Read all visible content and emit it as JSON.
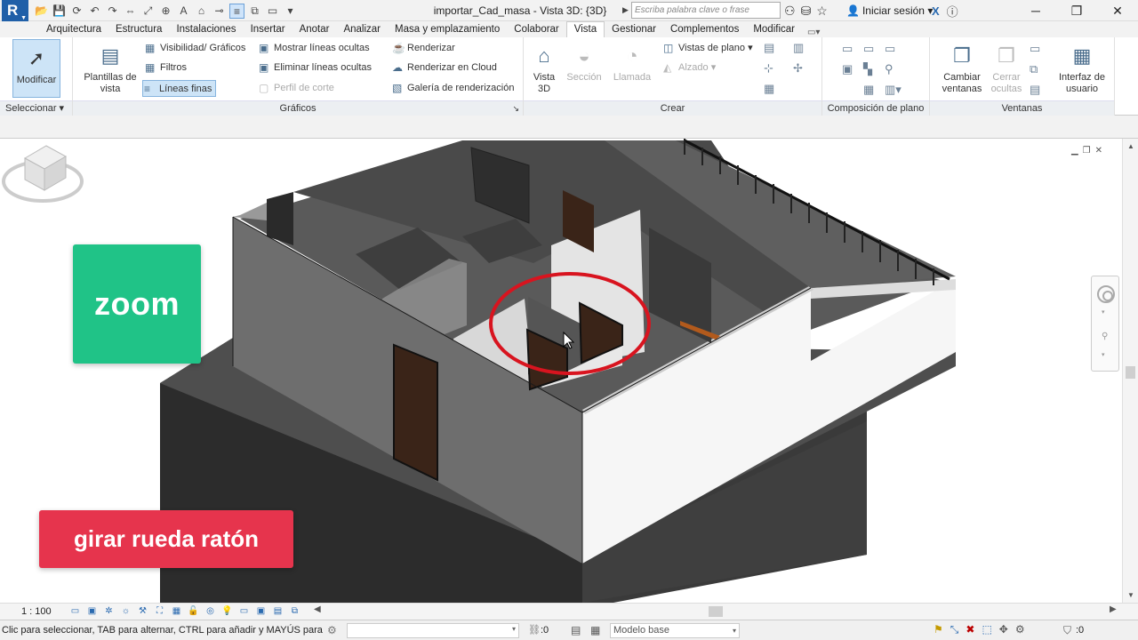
{
  "titlebar": {
    "doc_title": "importar_Cad_masa - Vista 3D: {3D}",
    "search_placeholder": "Escriba palabra clave o frase",
    "signin": "Iniciar sesión"
  },
  "tabs": [
    "Arquitectura",
    "Estructura",
    "Instalaciones",
    "Insertar",
    "Anotar",
    "Analizar",
    "Masa y emplazamiento",
    "Colaborar",
    "Vista",
    "Gestionar",
    "Complementos",
    "Modificar"
  ],
  "active_tab": "Vista",
  "ribbon": {
    "select": {
      "modificar": "Modificar",
      "label": "Seleccionar"
    },
    "graficos": {
      "plantillas": "Plantillas de vista",
      "visibilidad": "Visibilidad/ Gráficos",
      "filtros": "Filtros",
      "lineas_finas": "Líneas finas",
      "mostrar_lineas": "Mostrar líneas ocultas",
      "eliminar_lineas": "Eliminar líneas ocultas",
      "perfil_corte": "Perfil de corte",
      "renderizar": "Renderizar",
      "renderizar_cloud": "Renderizar  en Cloud",
      "galeria": "Galería de  renderización",
      "label": "Gráficos"
    },
    "crear": {
      "vista3d": "Vista 3D",
      "seccion": "Sección",
      "llamada": "Llamada",
      "vistas_plano": "Vistas de plano",
      "alzado": "Alzado",
      "label": "Crear"
    },
    "composicion": {
      "label": "Composición de plano"
    },
    "ventanas": {
      "cambiar": "Cambiar ventanas",
      "cerrar": "Cerrar ocultas",
      "interfaz": "Interfaz de usuario",
      "label": "Ventanas"
    }
  },
  "overlays": {
    "zoom": "zoom",
    "rueda": "girar rueda ratón"
  },
  "viewbar": {
    "scale": "1 : 100"
  },
  "statusbar": {
    "text": "Clic para seleccionar, TAB para alternar, CTRL para añadir y MAYÚS para a",
    "count": ":0",
    "model": "Modelo base",
    "filter_count": ":0"
  },
  "colors": {
    "zoom_badge": "#20c387",
    "rueda_badge": "#e6344d",
    "highlight_circle": "#d8141f",
    "app_logo": "#1f5fa8"
  }
}
